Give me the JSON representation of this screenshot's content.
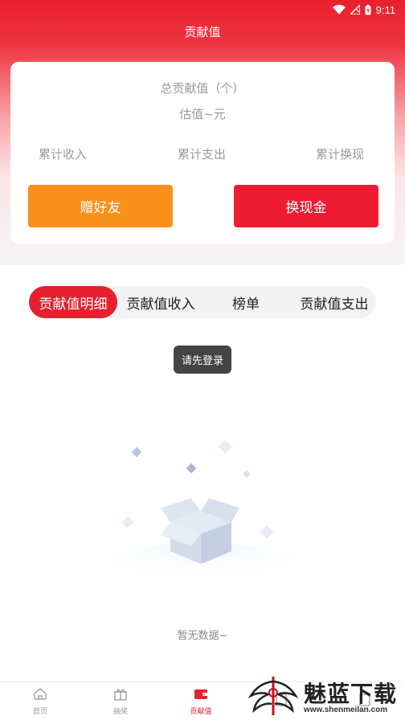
{
  "status_bar": {
    "time": "9:11"
  },
  "header": {
    "title": "贡献值"
  },
  "summary": {
    "total_label": "总贡献值（个）",
    "estimate_label": "估值~元",
    "stats": [
      {
        "label": "累计收入"
      },
      {
        "label": "累计支出"
      },
      {
        "label": "累计换现"
      }
    ],
    "gift_button": "赠好友",
    "cash_button": "换现金",
    "colors": {
      "gift": "#f89119",
      "cash": "#ee1c33"
    }
  },
  "tabs": [
    {
      "label": "贡献值明细",
      "active": true
    },
    {
      "label": "贡献值收入",
      "active": false
    },
    {
      "label": "榜单",
      "active": false
    },
    {
      "label": "贡献值支出",
      "active": false
    }
  ],
  "toast": "请先登录",
  "empty": {
    "text": "暂无数据~"
  },
  "bottom_nav": [
    {
      "label": "首页",
      "icon": "home-icon",
      "active": false
    },
    {
      "label": "抽奖",
      "icon": "gift-icon",
      "active": false
    },
    {
      "label": "贡献值",
      "icon": "wallet-icon",
      "active": true
    },
    {
      "label": "",
      "icon": "tasks-icon",
      "active": false
    },
    {
      "label": "",
      "icon": "profile-icon",
      "active": false
    }
  ],
  "watermark": {
    "title": "魅蓝下载",
    "url": "www.shenmeilan.com"
  },
  "accent_color": "#e5202f"
}
